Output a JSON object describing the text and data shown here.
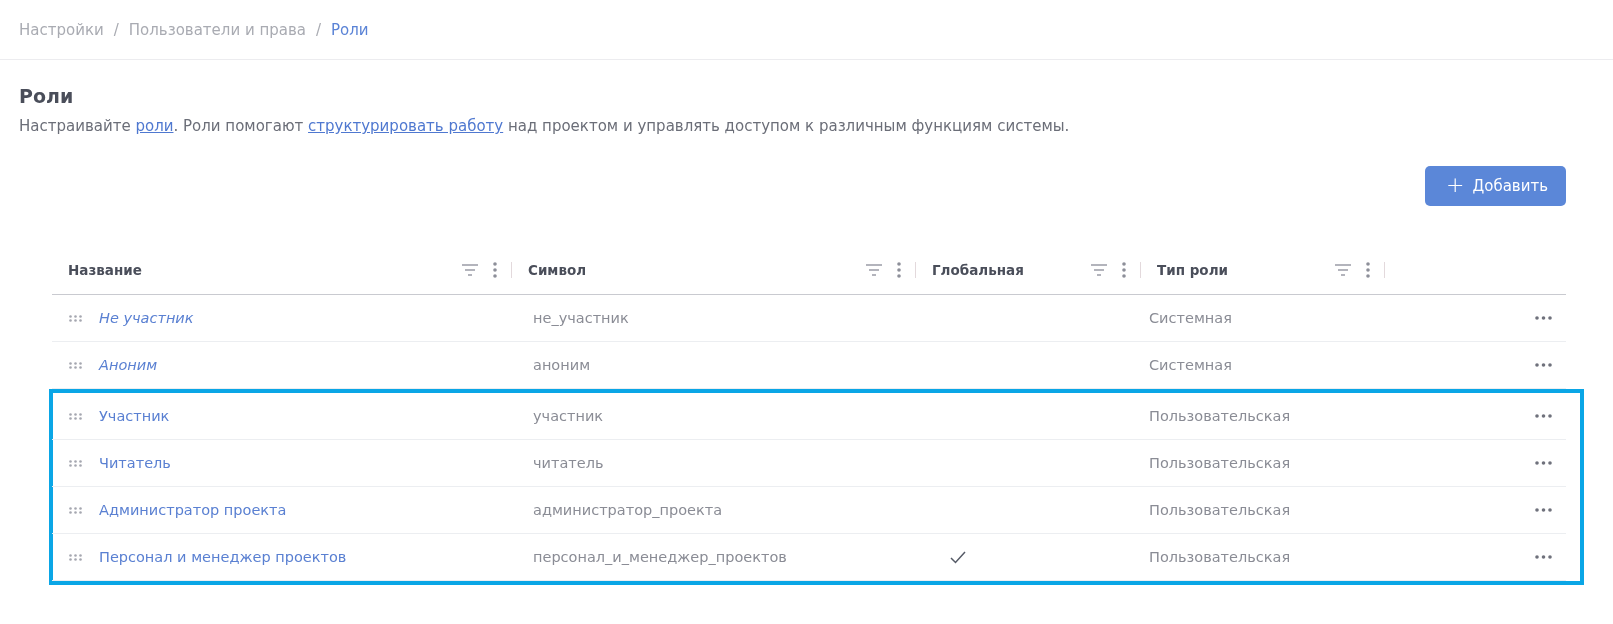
{
  "breadcrumbs": [
    {
      "label": "Настройки",
      "selected": false
    },
    {
      "label": "Пользователи и права",
      "selected": false
    },
    {
      "label": "Роли",
      "selected": true
    }
  ],
  "breadcrumb_separator": "/",
  "page": {
    "title": "Роли",
    "description": [
      {
        "text": "Настраивайте ",
        "link": false
      },
      {
        "text": "роли",
        "link": true
      },
      {
        "text": ". Роли помогают ",
        "link": false
      },
      {
        "text": "структурировать работу",
        "link": true
      },
      {
        "text": " над проектом и управлять доступом к различным функциям системы.",
        "link": false
      }
    ]
  },
  "add_button": {
    "icon": "+",
    "label": "Добавить"
  },
  "table": {
    "columns": [
      "Название",
      "Символ",
      "Глобальная",
      "Тип роли"
    ],
    "rows": [
      {
        "name": "Не участник",
        "symbol": "не_участник",
        "global": false,
        "type": "Системная",
        "system": true,
        "highlighted": false
      },
      {
        "name": "Аноним",
        "symbol": "аноним",
        "global": false,
        "type": "Системная",
        "system": true,
        "highlighted": false
      },
      {
        "name": "Участник",
        "symbol": "участник",
        "global": false,
        "type": "Пользовательская",
        "system": false,
        "highlighted": true
      },
      {
        "name": "Читатель",
        "symbol": "читатель",
        "global": false,
        "type": "Пользовательская",
        "system": false,
        "highlighted": true
      },
      {
        "name": "Администратор проекта",
        "symbol": "администратор_проекта",
        "global": false,
        "type": "Пользовательская",
        "system": false,
        "highlighted": true
      },
      {
        "name": "Персонал и менеджер проектов",
        "symbol": "персонал_и_менеджер_проектов",
        "global": true,
        "type": "Пользовательская",
        "system": false,
        "highlighted": true
      }
    ]
  }
}
